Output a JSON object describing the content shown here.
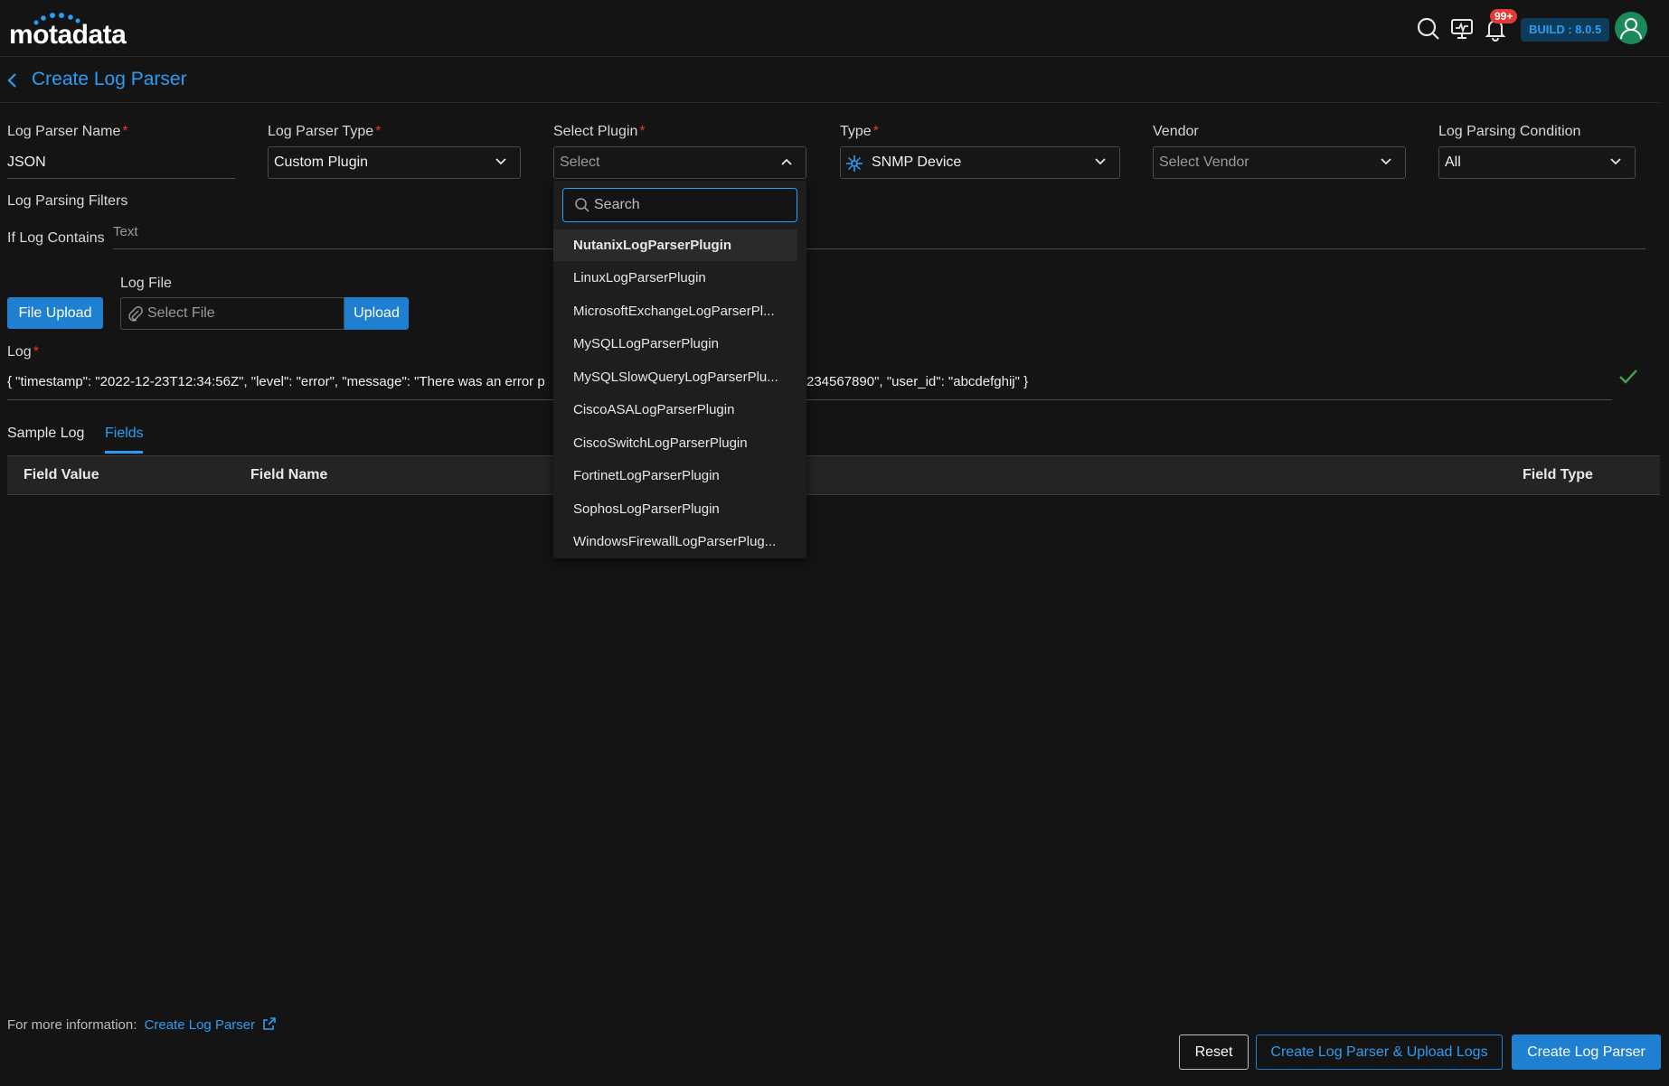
{
  "app": {
    "logo": "motadata",
    "build": "BUILD : 8.0.5",
    "notifications": "99+"
  },
  "page": {
    "title": "Create Log Parser"
  },
  "form": {
    "name_label": "Log Parser Name",
    "name_value": "JSON",
    "type_label": "Log Parser Type",
    "type_value": "Custom Plugin",
    "plugin_label": "Select Plugin",
    "plugin_placeholder": "Select",
    "device_type_label": "Type",
    "device_type_value": "SNMP Device",
    "vendor_label": "Vendor",
    "vendor_placeholder": "Select Vendor",
    "condition_label": "Log Parsing Condition",
    "condition_value": "All",
    "filters_label": "Log Parsing Filters",
    "if_contains_label": "If Log Contains",
    "if_contains_placeholder": "Text",
    "file_upload_button": "File Upload",
    "log_file_label": "Log File",
    "log_file_placeholder": "Select File",
    "upload_button": "Upload",
    "log_label": "Log",
    "log_value_left": "{ \"timestamp\": \"2022-12-23T12:34:56Z\", \"level\": \"error\", \"message\": \"There was an error p",
    "log_value_right": "234567890\", \"user_id\": \"abcdefghij\" }"
  },
  "tabs": [
    {
      "label": "Sample Log"
    },
    {
      "label": "Fields"
    }
  ],
  "table": {
    "columns": [
      "Field Value",
      "Field Name",
      "Field Type"
    ]
  },
  "dropdown": {
    "search_placeholder": "Search",
    "items": [
      "NutanixLogParserPlugin",
      "LinuxLogParserPlugin",
      "MicrosoftExchangeLogParserPl...",
      "MySQLLogParserPlugin",
      "MySQLSlowQueryLogParserPlu...",
      "CiscoASALogParserPlugin",
      "CiscoSwitchLogParserPlugin",
      "FortinetLogParserPlugin",
      "SophosLogParserPlugin",
      "WindowsFirewallLogParserPlug..."
    ]
  },
  "footer": {
    "info_text": "For more information:",
    "info_link": "Create Log Parser",
    "reset_button": "Reset",
    "create_upload_button": "Create Log Parser & Upload Logs",
    "create_button": "Create Log Parser"
  },
  "colors": {
    "accent": "#2a9df4",
    "required": "#e53935",
    "success": "#43a047"
  }
}
